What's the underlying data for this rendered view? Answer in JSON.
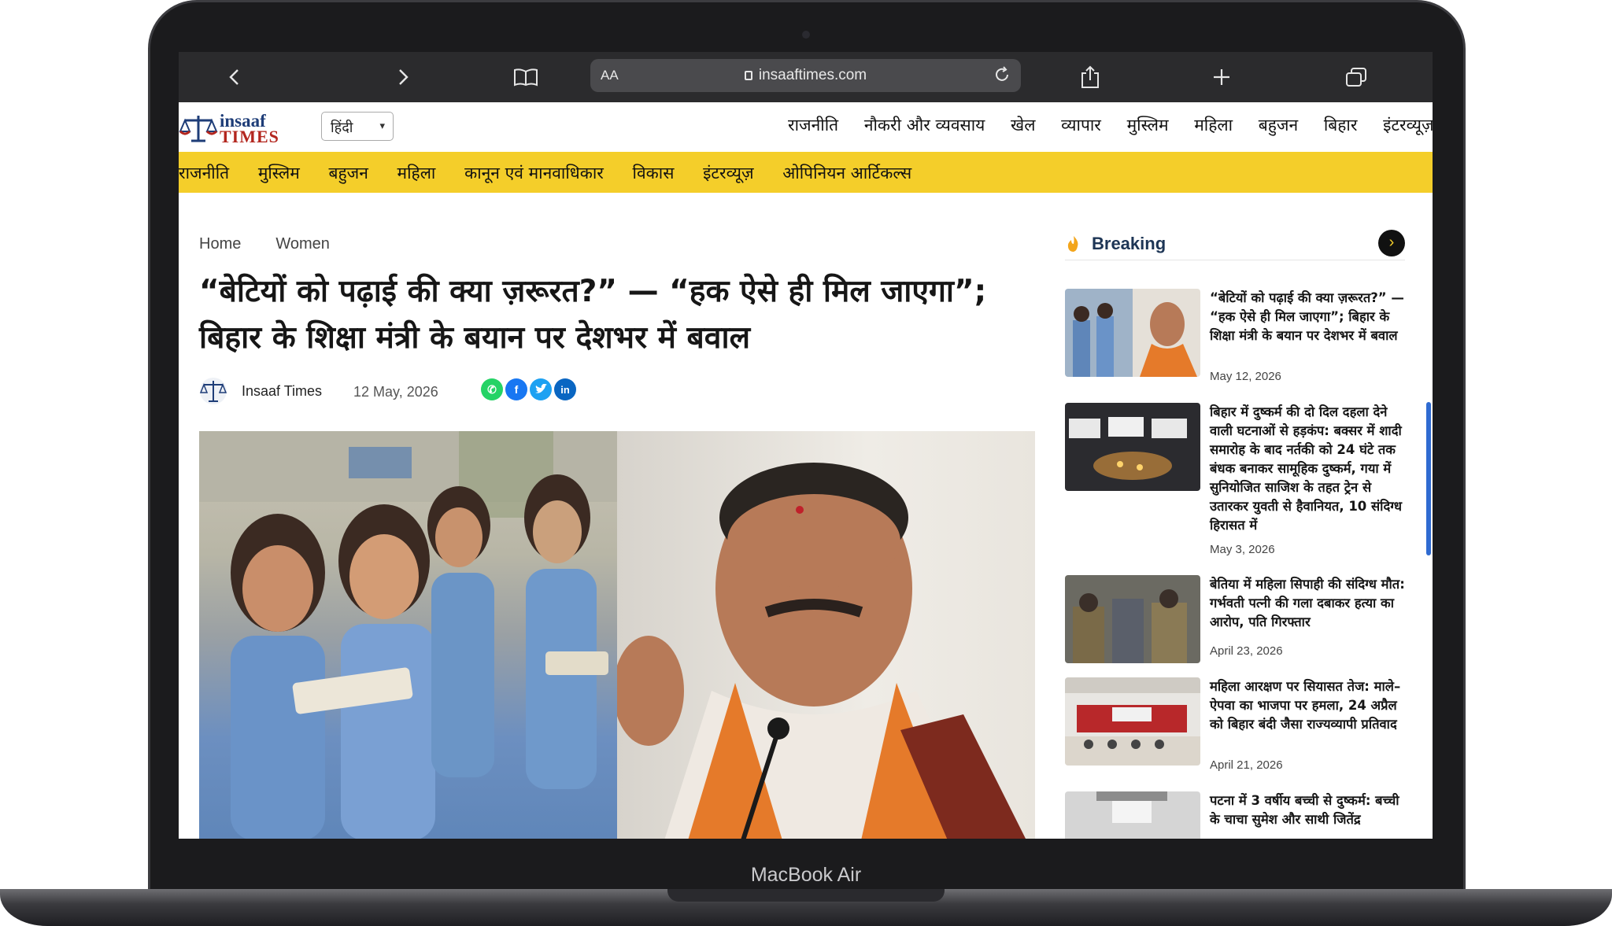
{
  "device": {
    "label": "MacBook Air"
  },
  "browser": {
    "address_aa": "AA",
    "url": "insaaftimes.com"
  },
  "site": {
    "logo_line1": "insaaf",
    "logo_line2": "TIMES",
    "language": "हिंदी",
    "top_nav": [
      "राजनीति",
      "नौकरी और व्यवसाय",
      "खेल",
      "व्यापार",
      "मुस्लिम",
      "महिला",
      "बहुजन",
      "बिहार",
      "इंटरव्यूज़"
    ],
    "yellow_nav": [
      "राजनीति",
      "मुस्लिम",
      "बहुजन",
      "महिला",
      "कानून एवं मानवाधिकार",
      "विकास",
      "इंटरव्यूज़",
      "ओपिनियन आर्टिकल्स"
    ],
    "accent": "#f4ce2a"
  },
  "article": {
    "breadcrumb": [
      "Home",
      "Women"
    ],
    "headline": "“बेटियों को पढ़ाई की क्या ज़रूरत?” — “हक ऐसे ही मिल जाएगा”; बिहार के शिक्षा मंत्री के बयान पर देशभर में बवाल",
    "author": "Insaaf Times",
    "date": "12 May, 2026",
    "share_icons": [
      "whatsapp-icon",
      "facebook-icon",
      "twitter-icon",
      "linkedin-icon"
    ]
  },
  "sidebar": {
    "title": "Breaking",
    "items": [
      {
        "title": "“बेटियों को पढ़ाई की क्या ज़रूरत?” — “हक ऐसे ही मिल जाएगा”; बिहार के शिक्षा मंत्री के बयान पर देशभर में बवाल",
        "date": "May 12, 2026"
      },
      {
        "title": "बिहार में दुष्कर्म की दो दिल दहला देने वाली घटनाओं से हड़कंप: बक्सर में शादी समारोह के बाद नर्तकी को 24 घंटे तक बंधक बनाकर सामूहिक दुष्कर्म, गया में सुनियोजित साजिश के तहत ट्रेन से उतारकर युवती से हैवानियत, 10 संदिग्ध हिरासत में",
        "date": "May 3, 2026"
      },
      {
        "title": "बेतिया में महिला सिपाही की संदिग्ध मौत: गर्भवती पत्नी की गला दबाकर हत्या का आरोप, पति गिरफ्तार",
        "date": "April 23, 2026"
      },
      {
        "title": "महिला आरक्षण पर सियासत तेज: माले–ऐपवा का भाजपा पर हमला, 24 अप्रैल को बिहार बंदी जैसा राज्यव्यापी प्रतिवाद",
        "date": "April 21, 2026"
      },
      {
        "title": "पटना में 3 वर्षीय बच्ची से दुष्कर्म: बच्ची के चाचा सुमेश और साथी जितेंद्र",
        "date": ""
      }
    ]
  }
}
